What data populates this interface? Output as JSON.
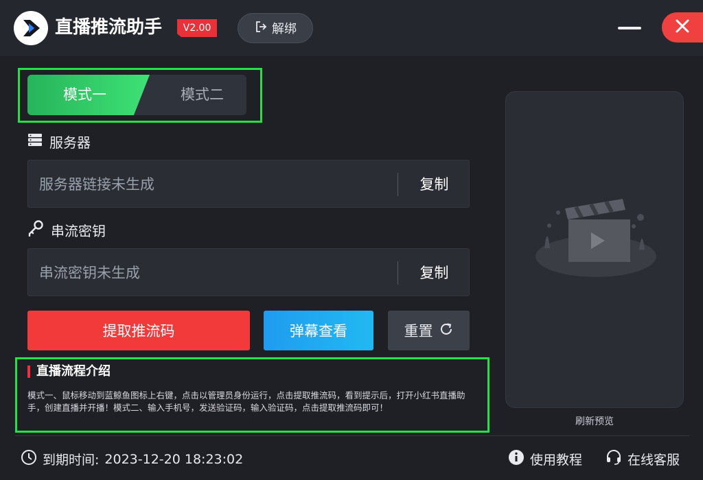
{
  "app": {
    "title": "直播推流助手",
    "version": "V2.00",
    "unbind_label": "解绑"
  },
  "modes": {
    "tab1": "模式一",
    "tab2": "模式二",
    "active": "模式一"
  },
  "server": {
    "label": "服务器",
    "value": "服务器链接未生成",
    "copy_label": "复制"
  },
  "stream_key": {
    "label": "串流密钥",
    "value": "串流密钥未生成",
    "copy_label": "复制"
  },
  "actions": {
    "extract": "提取推流码",
    "danmu": "弹幕查看",
    "reset": "重置"
  },
  "intro": {
    "title": "直播流程介绍",
    "body": "模式一、鼠标移动到蓝鲸鱼图标上右键，点击以管理员身份运行，点击提取推流码，看到提示后，打开小红书直播助手，创建直播并开播！模式二、输入手机号，发送验证码，输入验证码，点击提取推流码即可！"
  },
  "preview": {
    "refresh_label": "刷新预览"
  },
  "footer": {
    "expiry_label": "到期时间:",
    "expiry_value": "2023-12-20 18:23:02",
    "tutorial": "使用教程",
    "support": "在线客服"
  },
  "colors": {
    "accent_green": "#27b45b",
    "danger_red": "#f33a3a",
    "info_blue": "#1f9cf0",
    "highlight_green": "#22e24a"
  },
  "icons": [
    "logo-play-icon",
    "logout-icon",
    "minimize-icon",
    "close-icon",
    "server-icon",
    "key-icon",
    "refresh-icon",
    "clapperboard-illustration",
    "clock-icon",
    "info-icon",
    "headset-icon"
  ]
}
